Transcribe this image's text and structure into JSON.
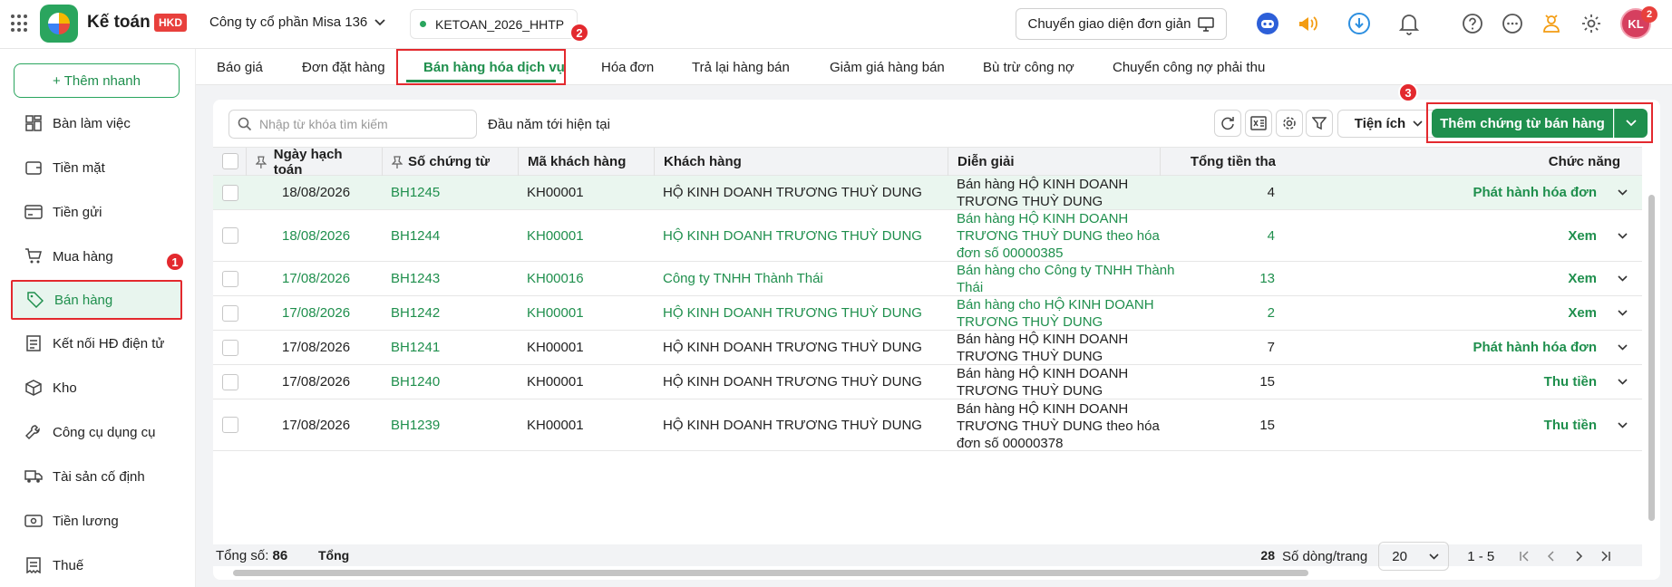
{
  "app": {
    "name": "Kế toán",
    "badge": "HKD",
    "company": "Công ty cổ phần Misa 136",
    "database": "KETOAN_2026_HHTP",
    "simple_view_label": "Chuyển giao diện đơn giản",
    "avatar_initials": "KL",
    "notification_count": "2",
    "brand_color": "#1f8f4d"
  },
  "sidebar": {
    "quick_add": "+ Thêm nhanh",
    "items": [
      {
        "label": "Bàn làm việc",
        "icon": "dashboard-icon"
      },
      {
        "label": "Tiền mặt",
        "icon": "wallet-icon"
      },
      {
        "label": "Tiền gửi",
        "icon": "card-icon"
      },
      {
        "label": "Mua hàng",
        "icon": "cart-icon"
      },
      {
        "label": "Bán hàng",
        "icon": "tag-icon"
      },
      {
        "label": "Kết nối HĐ điện tử",
        "icon": "invoice-icon"
      },
      {
        "label": "Kho",
        "icon": "box-icon"
      },
      {
        "label": "Công cụ dụng cụ",
        "icon": "tools-icon"
      },
      {
        "label": "Tài sản cố định",
        "icon": "truck-icon"
      },
      {
        "label": "Tiền lương",
        "icon": "money-icon"
      },
      {
        "label": "Thuế",
        "icon": "tax-icon"
      }
    ]
  },
  "annotations": {
    "step1": "1",
    "step2": "2",
    "step3": "3"
  },
  "tabs": [
    "Báo giá",
    "Đơn đặt hàng",
    "Bán hàng hóa dịch vụ",
    "Hóa đơn",
    "Trả lại hàng bán",
    "Giảm giá hàng bán",
    "Bù trừ công nợ",
    "Chuyển công nợ phải thu"
  ],
  "toolbar": {
    "search_placeholder": "Nhập từ khóa tìm kiếm",
    "period": "Đầu năm tới hiện tại",
    "utilities": "Tiện ích",
    "add_voucher": "Thêm chứng từ bán hàng"
  },
  "table": {
    "headers": [
      "Ngày hạch toán",
      "Số chứng từ",
      "Mã khách hàng",
      "Khách hàng",
      "Diễn giải",
      "Tổng tiền tha",
      "Chức năng"
    ],
    "rows": [
      {
        "date": "18/08/2026",
        "no": "BH1245",
        "code": "KH00001",
        "customer": "HỘ KINH DOANH TRƯƠNG THUỲ DUNG",
        "desc": "Bán hàng HỘ KINH DOANH TRƯƠNG THUỲ DUNG",
        "total": "4",
        "action": "Phát hành hóa đơn"
      },
      {
        "date": "18/08/2026",
        "no": "BH1244",
        "code": "KH00001",
        "customer": "HỘ KINH DOANH TRƯƠNG THUỲ DUNG",
        "desc": "Bán hàng HỘ KINH DOANH TRƯƠNG THUỲ DUNG theo hóa đơn số 00000385",
        "total": "4",
        "action": "Xem"
      },
      {
        "date": "17/08/2026",
        "no": "BH1243",
        "code": "KH00016",
        "customer": "Công ty TNHH Thành Thái",
        "desc": "Bán hàng cho Công ty TNHH Thành Thái",
        "total": "13",
        "action": "Xem"
      },
      {
        "date": "17/08/2026",
        "no": "BH1242",
        "code": "KH00001",
        "customer": "HỘ KINH DOANH TRƯƠNG THUỲ DUNG",
        "desc": "Bán hàng cho HỘ KINH DOANH TRƯƠNG THUỲ DUNG",
        "total": "2",
        "action": "Xem"
      },
      {
        "date": "17/08/2026",
        "no": "BH1241",
        "code": "KH00001",
        "customer": "HỘ KINH DOANH TRƯƠNG THUỲ DUNG",
        "desc": "Bán hàng HỘ KINH DOANH TRƯƠNG THUỲ DUNG",
        "total": "7",
        "action": "Phát hành hóa đơn"
      },
      {
        "date": "17/08/2026",
        "no": "BH1240",
        "code": "KH00001",
        "customer": "HỘ KINH DOANH TRƯƠNG THUỲ DUNG",
        "desc": "Bán hàng HỘ KINH DOANH TRƯƠNG THUỲ DUNG",
        "total": "15",
        "action": "Thu tiền"
      },
      {
        "date": "17/08/2026",
        "no": "BH1239",
        "code": "KH00001",
        "customer": "HỘ KINH DOANH TRƯƠNG THUỲ DUNG",
        "desc": "Bán hàng HỘ KINH DOANH TRƯƠNG THUỲ DUNG theo hóa đơn số 00000378",
        "total": "15",
        "action": "Thu tiền"
      }
    ],
    "total_label": "Tổng",
    "total_value": "28"
  },
  "footer": {
    "count_label": "Tổng số:",
    "count": "86",
    "rows_per_page_label": "Số dòng/trang",
    "rows_per_page": "20",
    "range": "1 - 5"
  }
}
